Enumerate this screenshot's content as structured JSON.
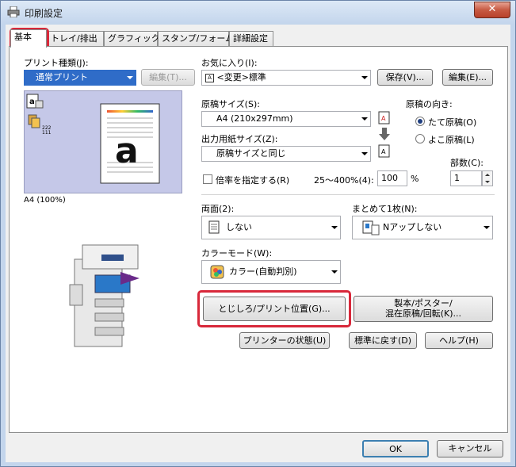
{
  "window": {
    "title": "印刷設定",
    "close_label": "✕"
  },
  "tabs": [
    "基本",
    "トレイ/排出",
    "グラフィックス",
    "スタンプ/フォーム",
    "詳細設定"
  ],
  "print_type": {
    "label": "プリント種類(J):",
    "value": "通常プリント",
    "edit_button": "編集(T)..."
  },
  "favorites": {
    "label": "お気に入り(I):",
    "value": "<変更>標準",
    "save_button": "保存(V)...",
    "edit_button": "編集(E)..."
  },
  "preview": {
    "caption": "A4 (100%)",
    "glyph": "a",
    "copies_badge": "222\n111"
  },
  "original_size": {
    "label": "原稿サイズ(S):",
    "value": "A4 (210x297mm)"
  },
  "output_size": {
    "label": "出力用紙サイズ(Z):",
    "value": "原稿サイズと同じ"
  },
  "orientation": {
    "label": "原稿の向き:",
    "portrait": "たて原稿(O)",
    "landscape": "よこ原稿(L)"
  },
  "copies": {
    "label": "部数(C):",
    "value": "1"
  },
  "zoom": {
    "checkbox_label": "倍率を指定する(R)",
    "range": "25〜400%(4):",
    "value": "100",
    "unit": "%"
  },
  "duplex": {
    "label": "両面(2):",
    "value": "しない"
  },
  "nup": {
    "label": "まとめて1枚(N):",
    "value": "Nアップしない"
  },
  "color_mode": {
    "label": "カラーモード(W):",
    "value": "カラー(自動判別)"
  },
  "buttons": {
    "binding": "とじしろ/プリント位置(G)...",
    "booklet_line1": "製本/ポスター/",
    "booklet_line2": "混在原稿/回転(K)...",
    "printer_status": "プリンターの状態(U)",
    "restore_default": "標準に戻す(D)",
    "help": "ヘルプ(H)",
    "ok": "OK",
    "cancel": "キャンセル"
  },
  "colors": {
    "highlight": "#d8283a",
    "accent": "#1f3f80"
  }
}
